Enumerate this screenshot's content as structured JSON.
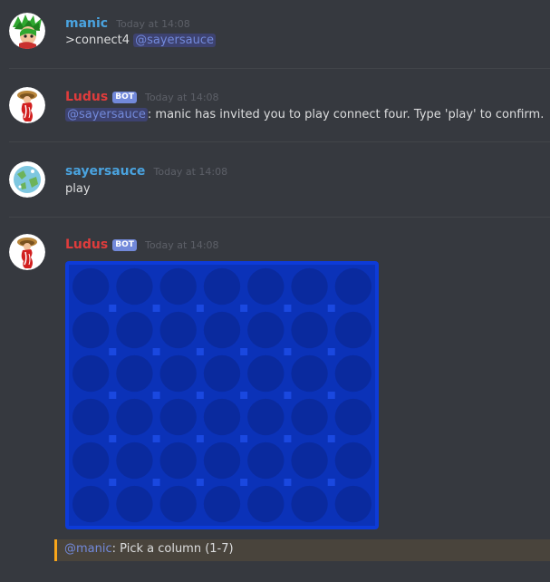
{
  "colors": {
    "background": "#36393f",
    "manic": "#4aa3df",
    "ludus": "#e03c3c",
    "sayersauce": "#4aa3df",
    "mention_fg": "#7289da",
    "mention_bg": "#3d4270",
    "bot_tag": "#7289da",
    "timestamp": "#5d6068",
    "highlight_accent": "#faa61a",
    "highlight_bg": "#49443c",
    "board_cell": "#0a2a9e",
    "board_frame": "#0d3bd8"
  },
  "messages": [
    {
      "author": "manic",
      "timestamp": "Today at 14:08",
      "text_prefix": ">connect4 ",
      "mention": "@sayersauce",
      "avatar_icon": "green-haired-character-avatar"
    },
    {
      "author": "Ludus",
      "bot_tag": "BOT",
      "timestamp": "Today at 14:08",
      "mention": "@sayersauce",
      "text_suffix": ": manic has invited you to play connect four. Type 'play' to confirm.",
      "avatar_icon": "red-mushroom-avatar"
    },
    {
      "author": "sayersauce",
      "timestamp": "Today at 14:08",
      "text": "play",
      "avatar_icon": "globe-avatar"
    },
    {
      "author": "Ludus",
      "bot_tag": "BOT",
      "timestamp": "Today at 14:08",
      "attachment_icon": "connect-four-board-image",
      "avatar_icon": "red-mushroom-avatar"
    }
  ],
  "highlight": {
    "mention": "@manic",
    "text": ": Pick a column (1-7)"
  }
}
